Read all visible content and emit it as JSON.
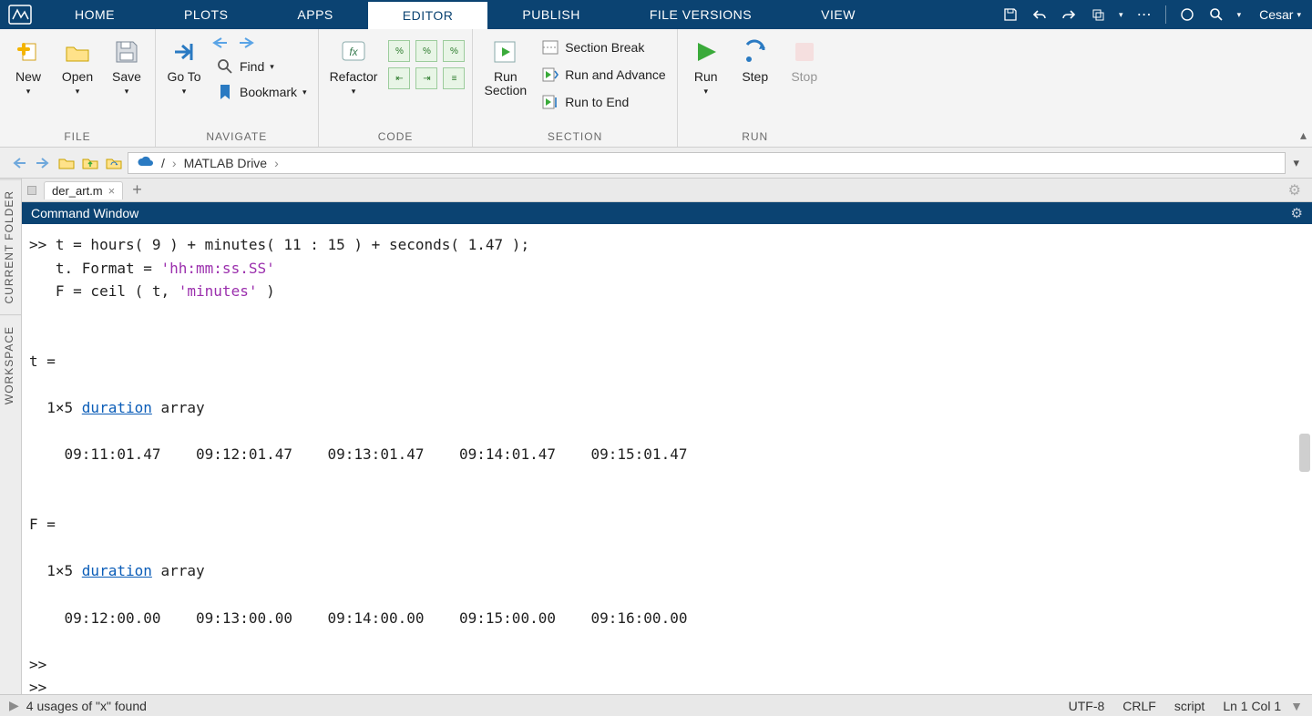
{
  "menu": {
    "tabs": [
      "HOME",
      "PLOTS",
      "APPS",
      "EDITOR",
      "PUBLISH",
      "FILE VERSIONS",
      "VIEW"
    ],
    "active_index": 3,
    "user": "Cesar"
  },
  "ribbon": {
    "file": {
      "label": "FILE",
      "new": "New",
      "open": "Open",
      "save": "Save"
    },
    "navigate": {
      "label": "NAVIGATE",
      "go_to": "Go To",
      "find": "Find",
      "bookmark": "Bookmark"
    },
    "code": {
      "label": "CODE",
      "refactor": "Refactor"
    },
    "section": {
      "label": "SECTION",
      "run_section": "Run\nSection",
      "section_break": "Section Break",
      "run_and_advance": "Run and Advance",
      "run_to_end": "Run to End"
    },
    "run": {
      "label": "RUN",
      "run": "Run",
      "step": "Step",
      "stop": "Stop"
    }
  },
  "address": {
    "root": "/",
    "crumb1": "MATLAB Drive"
  },
  "side": {
    "current_folder": "CURRENT FOLDER",
    "workspace": "WORKSPACE"
  },
  "file_tabs": {
    "file1": "der_art.m"
  },
  "cmdwin": {
    "title": "Command Window",
    "line1a": ">> t = hours( 9 ) + minutes( 11 : 15 ) + seconds( 1.47 );",
    "line2a": "   t. Format = ",
    "line2b": "'hh:mm:ss.SS'",
    "line3a": "   F = ceil ( t, ",
    "line3b": "'minutes'",
    "line3c": " )",
    "blank": "",
    "t_hdr": "t =",
    "arr_pre": "  1×5 ",
    "arr_link": "duration",
    "arr_post": " array",
    "t_vals": "    09:11:01.47    09:12:01.47    09:13:01.47    09:14:01.47    09:15:01.47",
    "f_hdr": "F =",
    "f_vals": "    09:12:00.00    09:13:00.00    09:14:00.00    09:15:00.00    09:16:00.00",
    "prompt": ">> "
  },
  "status": {
    "left": "4 usages of \"x\" found",
    "encoding": "UTF-8",
    "eol": "CRLF",
    "type": "script",
    "pos": "Ln 1 Col 1"
  }
}
